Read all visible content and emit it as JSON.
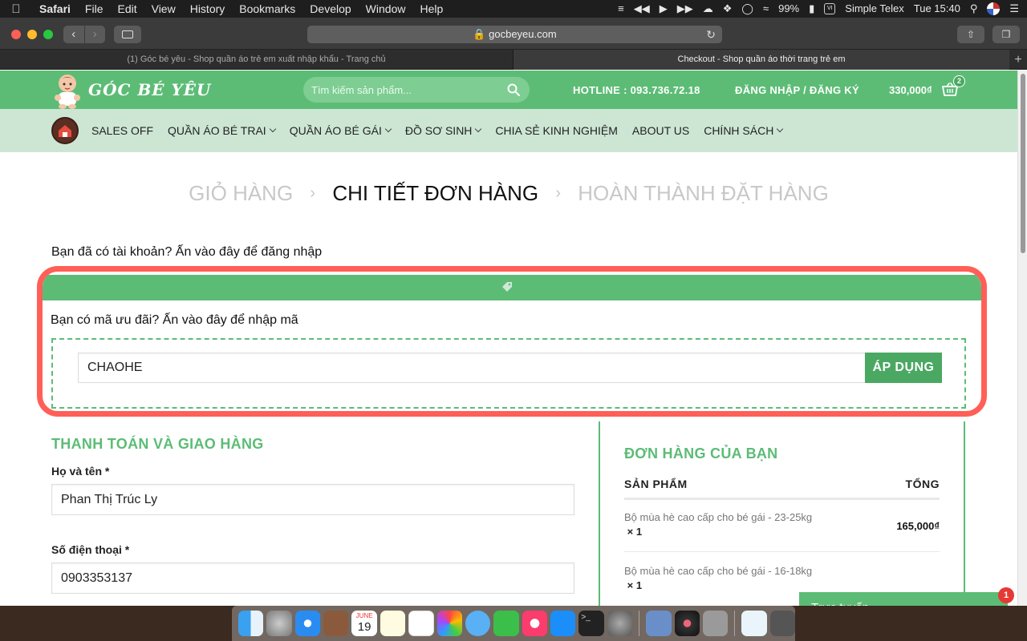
{
  "menubar": {
    "app": "Safari",
    "items": [
      "File",
      "Edit",
      "View",
      "History",
      "Bookmarks",
      "Develop",
      "Window",
      "Help"
    ],
    "battery": "99%",
    "input_method": "Simple Telex",
    "clock": "Tue 15:40"
  },
  "browser": {
    "url": "gocbeyeu.com",
    "tabs": [
      "(1) Góc bé yêu - Shop quần áo trẻ em xuất nhập khẩu - Trang chủ",
      "Checkout - Shop quần áo thời trang trẻ em"
    ]
  },
  "header": {
    "logo_text": "GÓC BÉ YÊU",
    "search_placeholder": "Tìm kiếm sản phẩm...",
    "hotline": "HOTLINE : 093.736.72.18",
    "login": "ĐĂNG NHẬP / ĐĂNG KÝ",
    "cart_total": "330,000₫",
    "cart_count": "2"
  },
  "nav": {
    "items": [
      "SALES OFF",
      "QUẦN ÁO BÉ TRAI",
      "QUẦN ÁO BÉ GÁI",
      "ĐỒ SƠ SINH",
      "CHIA SẺ KINH NGHIỆM",
      "ABOUT US",
      "CHÍNH SÁCH"
    ]
  },
  "steps": {
    "cart": "GIỎ HÀNG",
    "details": "CHI TIẾT ĐƠN HÀNG",
    "complete": "HOÀN THÀNH ĐẶT HÀNG",
    "separator": "›"
  },
  "login_notice": "Bạn đã có tài khoản? Ấn vào đây để đăng nhập",
  "coupon": {
    "prompt": "Bạn có mã ưu đãi? Ấn vào đây để nhập mã",
    "code": "CHAOHE",
    "apply": "ÁP DỤNG"
  },
  "billing": {
    "title": "THANH TOÁN VÀ GIAO HÀNG",
    "name_label": "Họ và tên *",
    "name_value": "Phan Thị Trúc Ly",
    "phone_label": "Số điện thoại *",
    "phone_value": "0903353137"
  },
  "order": {
    "title": "ĐƠN HÀNG CỦA BẠN",
    "col_product": "SẢN PHẨM",
    "col_total": "TỔNG",
    "items": [
      {
        "name": "Bộ mùa hè cao cấp cho bé gái - 23-25kg",
        "qty": "× 1",
        "price": "165,000₫"
      },
      {
        "name": "Bộ mùa hè cao cấp cho bé gái - 16-18kg",
        "qty": "× 1",
        "price": ""
      }
    ]
  },
  "chat": {
    "label": "Trực tuyến",
    "badge": "1"
  },
  "dock": {
    "calendar_month": "JUNE",
    "calendar_day": "19"
  }
}
